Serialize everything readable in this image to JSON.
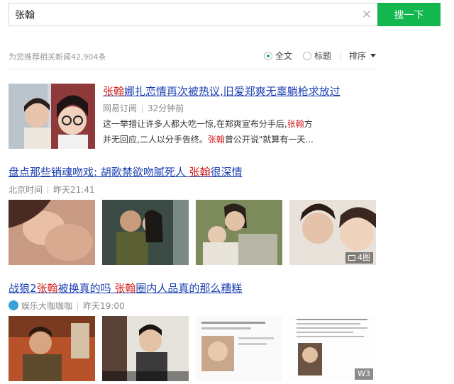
{
  "search": {
    "query": "张翰",
    "button_label": "搜一下"
  },
  "results_bar": {
    "count_text": "为您推荐相关新闻42,904条",
    "filter_full": "全文",
    "filter_title": "标题",
    "sort_label": "排序"
  },
  "articles": [
    {
      "title_parts": [
        "张翰",
        "娜扎恋情再次被热议,旧爱郑爽无辜躺枪求放过"
      ],
      "source": "网易订阅",
      "time": "32分钟前",
      "snippet_parts": [
        "这一举措让许多人都大吃一惊,在郑爽宣布分手后,",
        "张翰",
        "方并无回应,二人以分手告终。",
        "张翰",
        "曾公开说\"就算有一天..."
      ]
    },
    {
      "title_parts": [
        "盘点那些销魂吻戏: 胡歌禁欲吻腻死人 ",
        "张翰",
        "很深情"
      ],
      "source": "北京时间",
      "time": "昨天21:41",
      "badge": "4图"
    },
    {
      "title_parts": [
        "战狼2",
        "张翰",
        "被换真的吗 ",
        "张翰",
        "圈内人品真的那么糟糕"
      ],
      "source": "娱乐大咖咖咖",
      "time": "昨天19:00",
      "badge": "W3"
    }
  ],
  "colors": {
    "accent": "#12b74e",
    "link": "#1a3fb2",
    "highlight": "#d51e1e"
  }
}
